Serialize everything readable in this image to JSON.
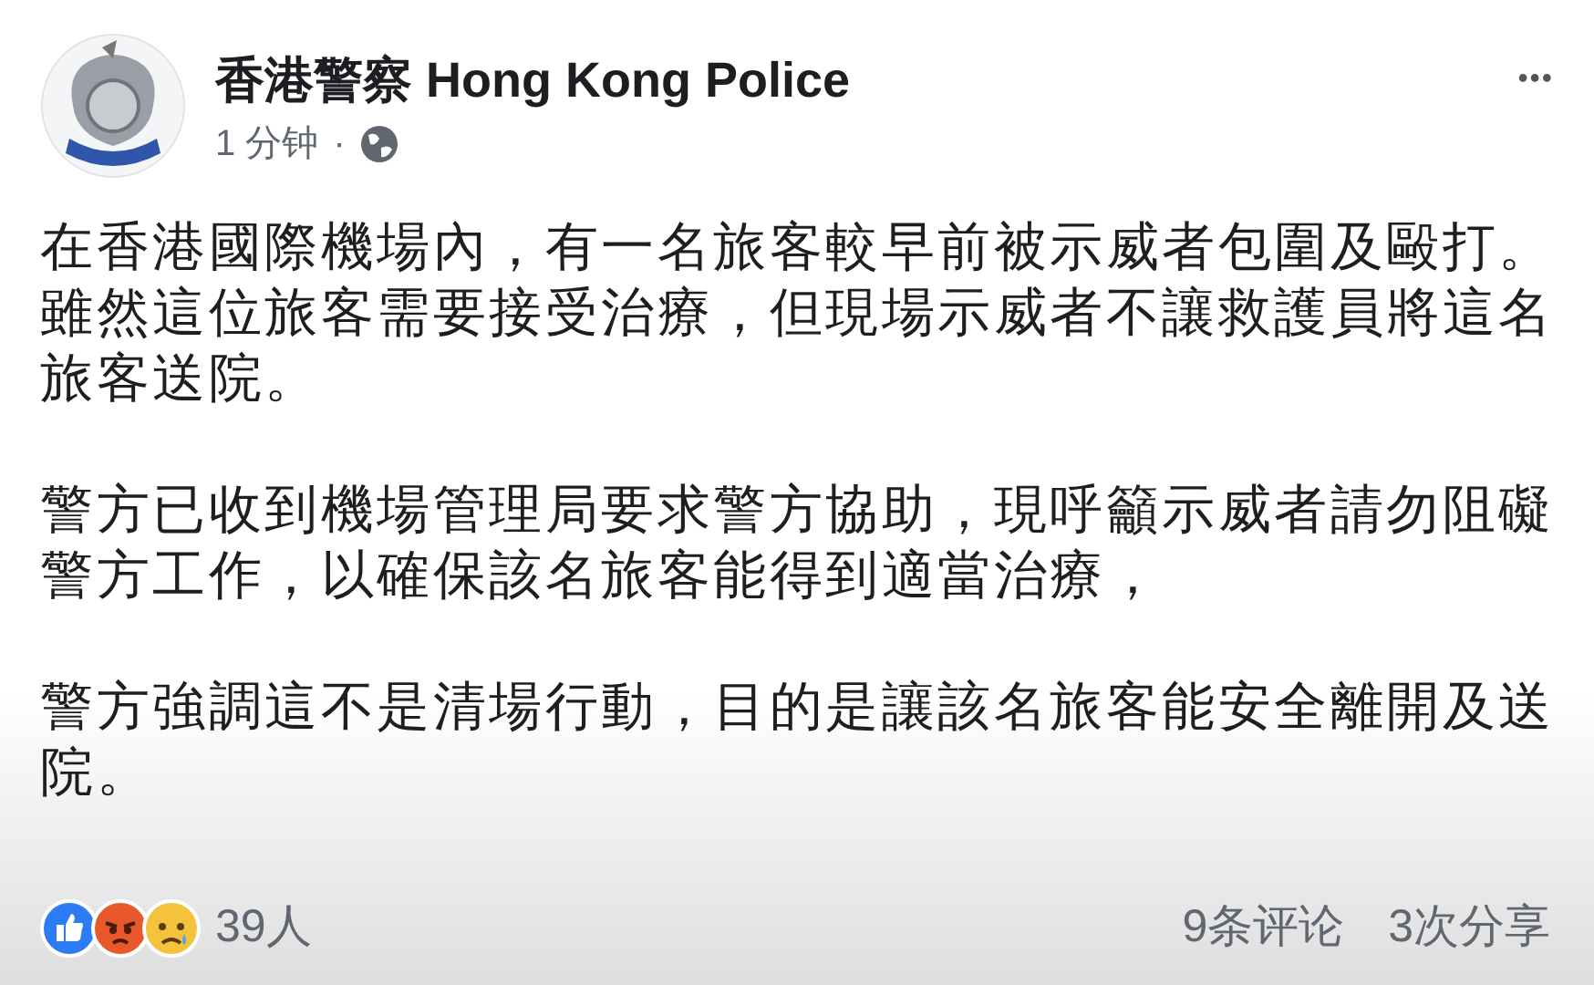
{
  "post": {
    "author": "香港警察 Hong Kong Police",
    "time": "1 分钟",
    "separator": "·",
    "menu": "•••",
    "paragraphs": [
      "在香港國際機場內，有一名旅客較早前被示威者包圍及毆打。雖然這位旅客需要接受治療，但現場示威者不讓救護員將這名旅客送院。",
      "警方已收到機場管理局要求警方協助，現呼籲示威者請勿阻礙警方工作，以確保該名旅客能得到適當治療，",
      "警方強調這不是清場行動，目的是讓該名旅客能安全離開及送院。"
    ],
    "reactions": [
      {
        "kind": "like"
      },
      {
        "kind": "angry"
      },
      {
        "kind": "sad"
      }
    ],
    "reaction_count": "39人",
    "comments": "9条评论",
    "shares": "3次分享"
  }
}
